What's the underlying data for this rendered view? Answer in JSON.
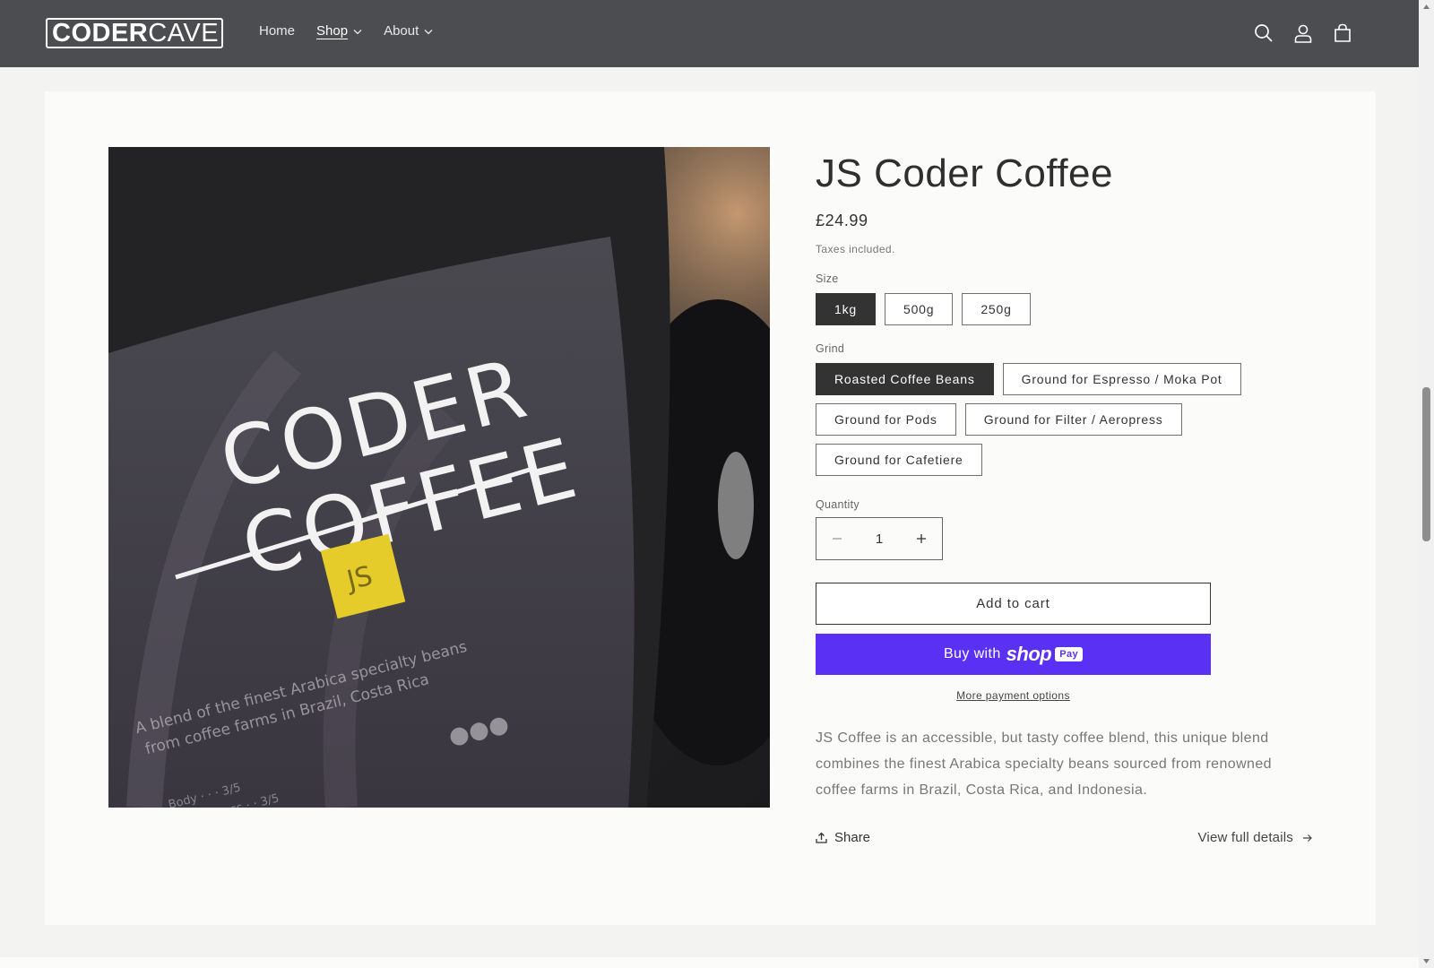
{
  "header": {
    "logo": {
      "bold": "CODER",
      "light": "CAVE"
    },
    "nav": [
      {
        "label": "Home",
        "has_dropdown": false,
        "active": false
      },
      {
        "label": "Shop",
        "has_dropdown": true,
        "active": true
      },
      {
        "label": "About",
        "has_dropdown": true,
        "active": false
      }
    ],
    "icons": [
      "search-icon",
      "account-icon",
      "cart-icon"
    ]
  },
  "product": {
    "image_icon": "coffee-bag-photo",
    "title": "JS Coder Coffee",
    "price": "£24.99",
    "tax_note": "Taxes included.",
    "size": {
      "label": "Size",
      "options": [
        "1kg",
        "500g",
        "250g"
      ],
      "selected": "1kg"
    },
    "grind": {
      "label": "Grind",
      "options": [
        "Roasted Coffee Beans",
        "Ground for Espresso / Moka Pot",
        "Ground for Pods",
        "Ground for Filter / Aeropress",
        "Ground for Cafetiere"
      ],
      "selected": "Roasted Coffee Beans"
    },
    "quantity": {
      "label": "Quantity",
      "value": "1"
    },
    "add_to_cart": "Add to cart",
    "buy_with": "Buy with",
    "shop_word": "shop",
    "pay_badge": "Pay",
    "more_payment": "More payment options",
    "description": "JS Coffee is an accessible, but tasty coffee blend, this unique blend combines the finest Arabica specialty beans sourced from renowned coffee farms in Brazil, Costa Rica, and Indonesia.",
    "share": "Share",
    "view_full": "View full details"
  },
  "colors": {
    "header_bg": "#4b4d50",
    "shop_pay": "#5a31f4",
    "selected_pill": "#333333"
  }
}
